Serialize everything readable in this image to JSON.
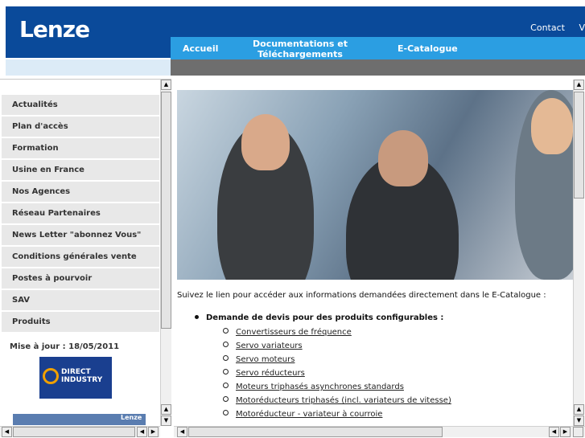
{
  "brand": {
    "logo_text": "Lenze"
  },
  "header": {
    "links": [
      "Contact",
      "V"
    ]
  },
  "nav": {
    "items": [
      {
        "label": "Accueil"
      },
      {
        "label": "Documentations et\nTéléchargements"
      },
      {
        "label": "E-Catalogue"
      }
    ]
  },
  "sidebar": {
    "items": [
      {
        "label": "Actualités"
      },
      {
        "label": "Plan d'accès"
      },
      {
        "label": "Formation"
      },
      {
        "label": "Usine en France"
      },
      {
        "label": "Nos Agences"
      },
      {
        "label": "Réseau Partenaires"
      },
      {
        "label": "News Letter \"abonnez Vous\""
      },
      {
        "label": "Conditions générales vente"
      },
      {
        "label": "Postes à pourvoir"
      },
      {
        "label": "SAV"
      },
      {
        "label": "Produits"
      }
    ],
    "update_text": "Mise à jour : 18/05/2011",
    "partner_logo": {
      "line1": "DIRECT",
      "line2": "INDUSTRY"
    },
    "thumb_logo": "Lenze"
  },
  "main": {
    "intro": "Suivez le lien pour accéder aux informations demandées directement dans le E-Catalogue :",
    "section_title": "Demande de devis pour des produits configurables :",
    "links": [
      "Convertisseurs de fréquence",
      "Servo variateurs",
      "Servo moteurs",
      "Servo réducteurs",
      "Moteurs triphasés asynchrones standards",
      "Motoréducteurs triphasés (incl. variateurs de vitesse)",
      "Motoréducteur - variateur à courroie"
    ]
  },
  "colors": {
    "brand_blue": "#0a4a9a",
    "nav_blue": "#2b9ee2"
  }
}
